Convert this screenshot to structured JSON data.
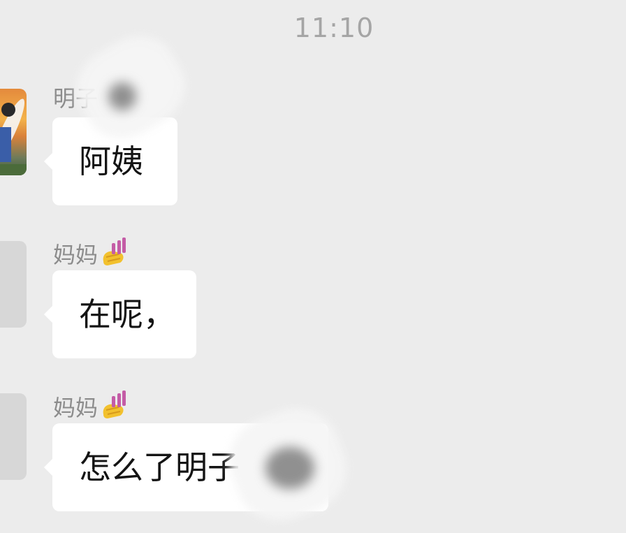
{
  "chat": {
    "timestamp": "11:10",
    "messages": [
      {
        "sender": "明子",
        "text": "阿姨",
        "avatar": "photo"
      },
      {
        "sender": "妈妈",
        "sender_emoji": "nail-polish-icon",
        "text": "在呢，",
        "avatar": "blank"
      },
      {
        "sender": "妈妈",
        "sender_emoji": "nail-polish-icon",
        "text": "怎么了明子",
        "avatar": "blank"
      }
    ]
  },
  "colors": {
    "background": "#ececec",
    "bubble": "#ffffff",
    "sender_text": "#8c8c8c",
    "timestamp_text": "#a5a5a5",
    "message_text": "#141414"
  }
}
